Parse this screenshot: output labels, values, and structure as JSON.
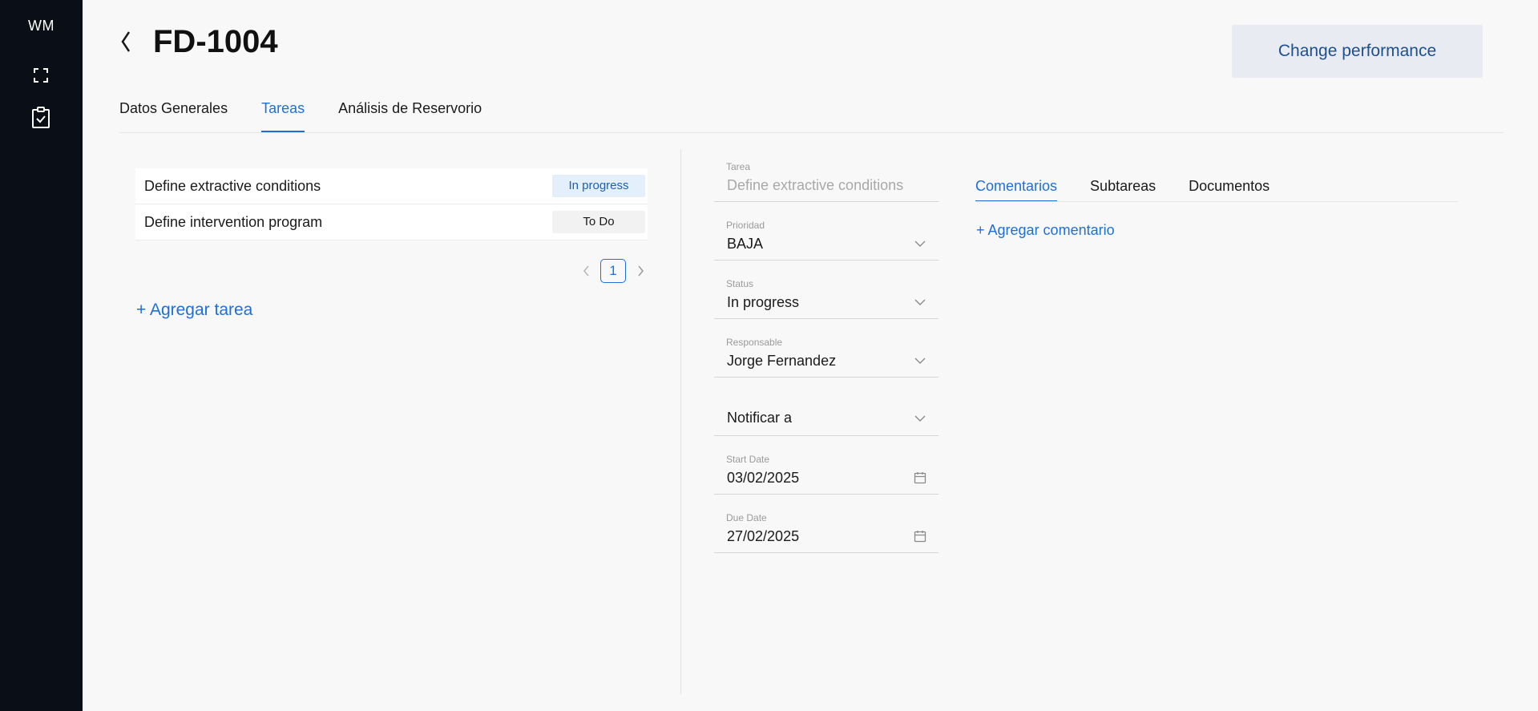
{
  "sidebar": {
    "logo": "WM",
    "icons": [
      {
        "name": "expand-icon"
      },
      {
        "name": "clipboard-check-icon"
      }
    ]
  },
  "header": {
    "title": "FD-1004",
    "action_button": "Change performance"
  },
  "tabs": [
    {
      "label": "Datos Generales",
      "active": false
    },
    {
      "label": "Tareas",
      "active": true
    },
    {
      "label": "Análisis de Reservorio",
      "active": false
    }
  ],
  "tasks": [
    {
      "name": "Define extractive conditions",
      "status": "In progress"
    },
    {
      "name": "Define intervention program",
      "status": "To Do"
    }
  ],
  "pagination": {
    "current_page": "1"
  },
  "add_task_label": "+ Agregar tarea",
  "form": {
    "tarea": {
      "label": "Tarea",
      "value": "Define extractive conditions"
    },
    "prioridad": {
      "label": "Prioridad",
      "value": "BAJA"
    },
    "status": {
      "label": "Status",
      "value": "In progress"
    },
    "responsable": {
      "label": "Responsable",
      "value": "Jorge Fernandez"
    },
    "notificar": {
      "value": "Notificar a"
    },
    "start_date": {
      "label": "Start Date",
      "value": "03/02/2025"
    },
    "due_date": {
      "label": "Due Date",
      "value": "27/02/2025"
    }
  },
  "detail_tabs": [
    {
      "label": "Comentarios",
      "active": true
    },
    {
      "label": "Subtareas",
      "active": false
    },
    {
      "label": "Documentos",
      "active": false
    }
  ],
  "add_comment_label": "+ Agregar comentario",
  "colors": {
    "accent": "#1f6fd6",
    "sidebar": "#0a0e16"
  }
}
